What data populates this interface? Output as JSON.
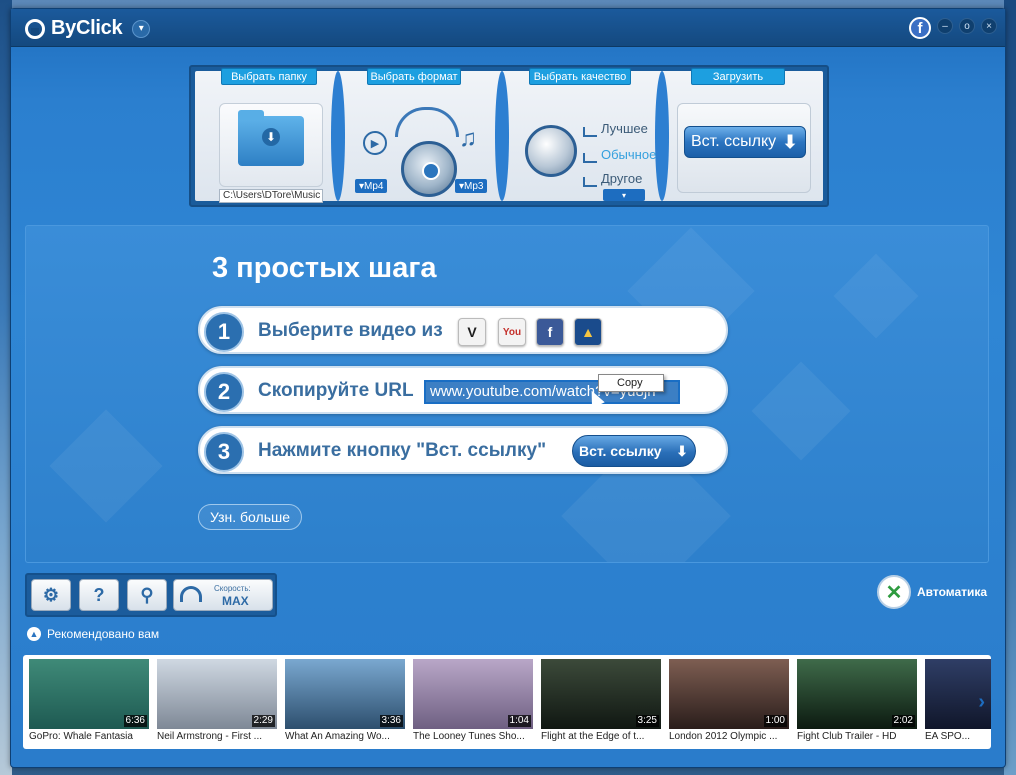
{
  "app": {
    "title": "ByClick",
    "facebook": "f",
    "window_controls": [
      "–",
      "o",
      "×"
    ]
  },
  "panel": {
    "folder_label": "Выбрать папку",
    "folder_path": "C:\\Users\\DTore\\Music",
    "format_label": "Выбрать формат",
    "format_video": "▾Mp4",
    "format_audio": "▾Mp3",
    "quality_label": "Выбрать качество",
    "quality_options": [
      "Лучшее",
      "Обычное",
      "Другое"
    ],
    "quality_selected": "Обычное",
    "download_label": "Загрузить",
    "paste_button": "Вст. ссылку"
  },
  "steps": {
    "title": "3 простых шага",
    "items": [
      {
        "num": "1",
        "text": "Выберите видео из"
      },
      {
        "num": "2",
        "text": "Скопируйте URL"
      },
      {
        "num": "3",
        "text": "Нажмите кнопку \"Вст. ссылку\""
      }
    ],
    "sites": [
      "vimeo",
      "youtube",
      "facebook",
      "dailymotion"
    ],
    "url_value": "www.youtube.com/watch?v=yu8jh",
    "context_menu": "Copy",
    "paste_button": "Вст. ссылку",
    "learn_more": "Узн. больше"
  },
  "toolbar": {
    "speed_label": "Скорость:",
    "speed_value": "MAX",
    "auto_label": "Автоматика"
  },
  "recommended": {
    "header": "Рекомендовано вам",
    "videos": [
      {
        "title": "GoPro: Whale Fantasia",
        "duration": "6:36",
        "colors": [
          "#3f8a78",
          "#1e5a52"
        ]
      },
      {
        "title": "Neil Armstrong - First ...",
        "duration": "2:29",
        "colors": [
          "#cfd8e2",
          "#7e8896"
        ]
      },
      {
        "title": "What An Amazing Wo...",
        "duration": "3:36",
        "colors": [
          "#7aa8d0",
          "#2d4f6e"
        ]
      },
      {
        "title": "The Looney Tunes Sho...",
        "duration": "1:04",
        "colors": [
          "#b9a7c8",
          "#6e5f82"
        ]
      },
      {
        "title": "Flight at the Edge of t...",
        "duration": "3:25",
        "colors": [
          "#3c4a3a",
          "#101712"
        ]
      },
      {
        "title": "London 2012 Olympic ...",
        "duration": "1:00",
        "colors": [
          "#7e5e52",
          "#2a1d1b"
        ]
      },
      {
        "title": "Fight Club Trailer - HD",
        "duration": "2:02",
        "colors": [
          "#3f6b4a",
          "#0c1a10"
        ]
      },
      {
        "title": "EA SPO...",
        "duration": "",
        "colors": [
          "#2f3e66",
          "#10162a"
        ]
      }
    ]
  }
}
